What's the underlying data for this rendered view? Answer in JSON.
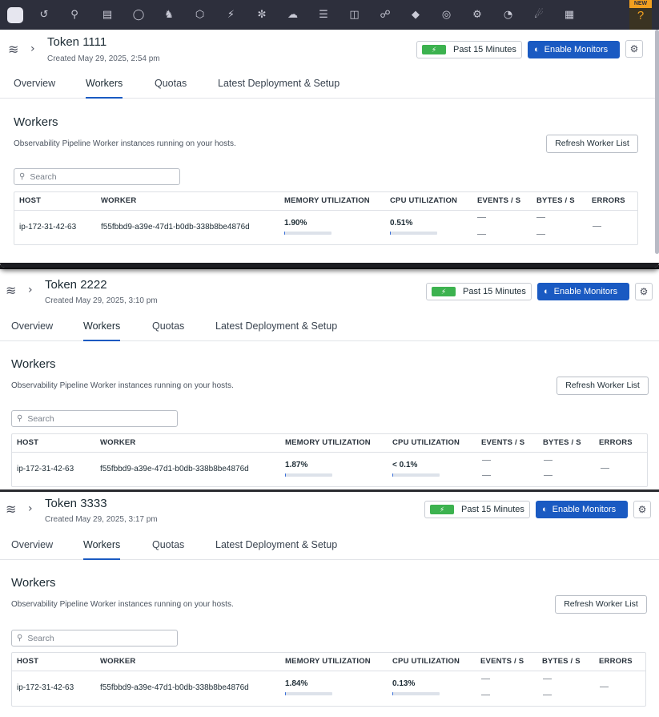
{
  "nav": {
    "icons": [
      "home-icon",
      "recent-icon",
      "search-icon",
      "dashboards-icon",
      "monitors-icon",
      "security-icon",
      "infrastructure-icon",
      "apm-icon",
      "integrations-icon",
      "logs-icon",
      "observability-pipelines-icon",
      "service-map-icon",
      "synthetics-icon",
      "ci-icon",
      "bugs-icon",
      "performance-icon",
      "rum-icon",
      "extensions-icon"
    ],
    "new_badge": "NEW",
    "help_glyph": "?"
  },
  "panels": [
    {
      "title": "Token 1111",
      "created": "Created May 29, 2025, 2:54 pm",
      "time_range": "Past 15 Minutes",
      "enable_monitors": "Enable Monitors",
      "tabs": [
        "Overview",
        "Workers",
        "Quotas",
        "Latest Deployment & Setup"
      ],
      "active_tab": "Workers",
      "section_title": "Workers",
      "section_desc": "Observability Pipeline Worker instances running on your hosts.",
      "refresh_label": "Refresh Worker List",
      "search_placeholder": "Search",
      "columns": [
        "HOST",
        "WORKER",
        "MEMORY UTILIZATION",
        "CPU UTILIZATION",
        "EVENTS / S",
        "BYTES / S",
        "ERRORS"
      ],
      "row": {
        "host": "ip-172-31-42-63",
        "worker": "f55fbbd9-a39e-47d1-b0db-338b8be4876d",
        "memory": "1.90%",
        "memory_fill_pct": 1.9,
        "cpu": "0.51%",
        "cpu_fill_pct": 0.51
      }
    },
    {
      "title": "Token 2222",
      "created": "Created May 29, 2025, 3:10 pm",
      "time_range": "Past 15 Minutes",
      "enable_monitors": "Enable Monitors",
      "tabs": [
        "Overview",
        "Workers",
        "Quotas",
        "Latest Deployment & Setup"
      ],
      "active_tab": "Workers",
      "section_title": "Workers",
      "section_desc": "Observability Pipeline Worker instances running on your hosts.",
      "refresh_label": "Refresh Worker List",
      "search_placeholder": "Search",
      "columns": [
        "HOST",
        "WORKER",
        "MEMORY UTILIZATION",
        "CPU UTILIZATION",
        "EVENTS / S",
        "BYTES / S",
        "ERRORS"
      ],
      "row": {
        "host": "ip-172-31-42-63",
        "worker": "f55fbbd9-a39e-47d1-b0db-338b8be4876d",
        "memory": "1.87%",
        "memory_fill_pct": 1.87,
        "cpu": "< 0.1%",
        "cpu_fill_pct": 0.05
      }
    },
    {
      "title": "Token 3333",
      "created": "Created May 29, 2025, 3:17 pm",
      "time_range": "Past 15 Minutes",
      "enable_monitors": "Enable Monitors",
      "tabs": [
        "Overview",
        "Workers",
        "Quotas",
        "Latest Deployment & Setup"
      ],
      "active_tab": "Workers",
      "section_title": "Workers",
      "section_desc": "Observability Pipeline Worker instances running on your hosts.",
      "refresh_label": "Refresh Worker List",
      "search_placeholder": "Search",
      "columns": [
        "HOST",
        "WORKER",
        "MEMORY UTILIZATION",
        "CPU UTILIZATION",
        "EVENTS / S",
        "BYTES / S",
        "ERRORS"
      ],
      "row": {
        "host": "ip-172-31-42-63",
        "worker": "f55fbbd9-a39e-47d1-b0db-338b8be4876d",
        "memory": "1.84%",
        "memory_fill_pct": 1.84,
        "cpu": "0.13%",
        "cpu_fill_pct": 0.13
      }
    }
  ],
  "colors": {
    "nav_bg": "#2d2f3c",
    "primary": "#1a5ac2",
    "live_green": "#3cb24f",
    "new_badge": "#f2a01f"
  }
}
